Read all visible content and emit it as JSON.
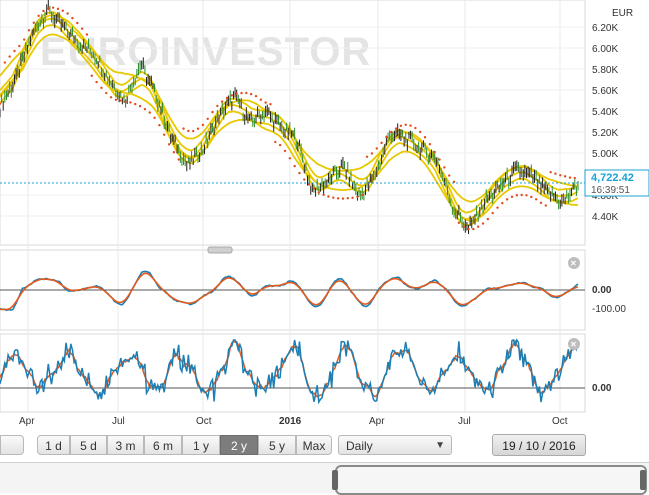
{
  "watermark": "EUROINVESTOR",
  "currency": "EUR",
  "price_axis": [
    "6.20K",
    "6.00K",
    "5.80K",
    "5.60K",
    "5.40K",
    "5.20K",
    "5.00K",
    "4.80K",
    "4.60K",
    "4.40K"
  ],
  "current_price": "4,722.42",
  "current_time": "16:39:51",
  "macd_axis": [
    "0.00",
    "-100.00"
  ],
  "osc_axis": [
    "0.00"
  ],
  "x_axis": [
    "Apr",
    "Jul",
    "Oct",
    "2016",
    "Apr",
    "Jul",
    "Oct"
  ],
  "ranges": [
    "1 d",
    "5 d",
    "3 m",
    "6 m",
    "1 y",
    "2 y",
    "5 y",
    "Max"
  ],
  "active_range": "2 y",
  "interval": "Daily",
  "date": "19 / 10 / 2016",
  "colors": {
    "price": "#1f1f1f",
    "bands": "#e8c800",
    "sar": "#e34a1d",
    "macd": "#1b7fb5",
    "signal": "#e35a1d",
    "accent": "#19a2d4"
  },
  "chart_data": {
    "type": "line",
    "title": "",
    "y_unit": "EUR",
    "ylim": [
      4200,
      6350
    ],
    "x_labels": [
      "Apr",
      "Jul",
      "Oct",
      "2016",
      "Apr",
      "Jul",
      "Oct"
    ],
    "series": [
      {
        "name": "",
        "values": [
          5450,
          5700,
          6100,
          6350,
          6200,
          6050,
          5950,
          5700,
          5500,
          5850,
          5550,
          5150,
          4900,
          5050,
          5350,
          5550,
          5300,
          5400,
          5250,
          5150,
          4650,
          4750,
          4900,
          4600,
          4800,
          5200,
          5150,
          5050,
          4950,
          4500,
          4300,
          4550,
          4700,
          4850,
          4800,
          4650,
          4550,
          4720
        ]
      }
    ]
  }
}
